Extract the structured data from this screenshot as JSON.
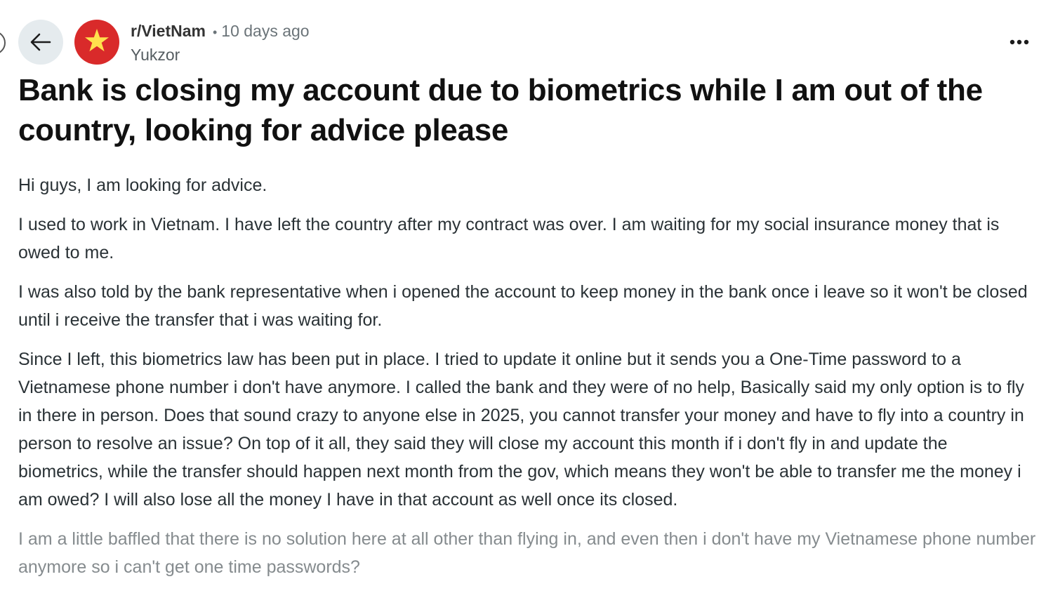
{
  "post": {
    "subreddit": "r/VietNam",
    "separator": "•",
    "time_ago": "10 days ago",
    "author": "Yukzor",
    "title": "Bank is closing my account due to biometrics while I am out of the country, looking for advice please",
    "paragraphs": [
      "Hi guys, I am looking for advice.",
      "I used to work in Vietnam. I have left the country after my contract was over. I am waiting for my social insurance money that is owed to me.",
      "I was also told by the bank representative when i opened the account to keep money in the bank once i leave so it won't be closed until i receive the transfer that i was waiting for.",
      "Since I left, this biometrics law has been put in place. I tried to update it online but it sends you a One-Time password to a Vietnamese phone number i don't have anymore. I called the bank and they were of no help, Basically said my only option is to fly in there in person. Does that sound crazy to anyone else in 2025, you cannot transfer your money and have to fly into a country in person to resolve an issue? On top of it all, they said they will close my account this month if i don't fly in and update the biometrics, while the transfer should happen next month from the gov, which means they won't be able to transfer me the money i am owed? I will also lose all the money I have in that account as well once its closed.",
      "I am a little baffled that there is no solution here at all other than flying in, and even then i don't have my Vietnamese phone number anymore so i can't get one time passwords?"
    ]
  },
  "icons": {
    "back": "back-arrow-icon",
    "avatar": "vietnam-flag-star-icon",
    "more": "more-options-icon"
  },
  "colors": {
    "avatar_bg": "#d92a2a",
    "star": "#ffe14d",
    "back_bg": "#e5ebee"
  }
}
